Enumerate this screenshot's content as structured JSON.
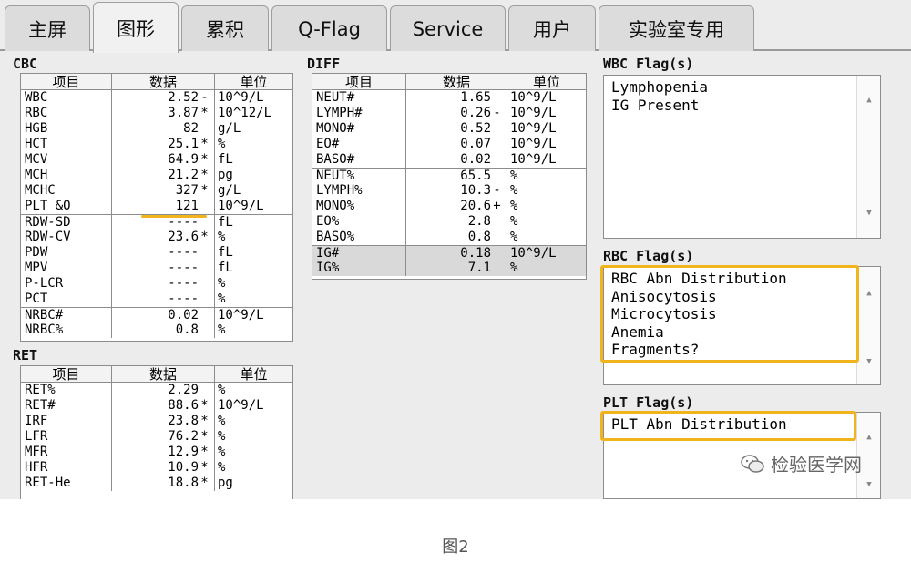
{
  "tabs": [
    {
      "label": "主屏"
    },
    {
      "label": "图形"
    },
    {
      "label": "累积"
    },
    {
      "label": "Q-Flag"
    },
    {
      "label": "Service"
    },
    {
      "label": "用户"
    },
    {
      "label": "实验室专用"
    }
  ],
  "active_tab": "图形",
  "cbc": {
    "title": "CBC",
    "headers": [
      "项目",
      "数据",
      "单位"
    ],
    "rows": [
      {
        "name": "WBC",
        "value": "2.52",
        "flag": "-",
        "unit": "10^9/L"
      },
      {
        "name": "RBC",
        "value": "3.87",
        "flag": "*",
        "unit": "10^12/L"
      },
      {
        "name": "HGB",
        "value": "82",
        "flag": "",
        "unit": "g/L"
      },
      {
        "name": "HCT",
        "value": "25.1",
        "flag": "*",
        "unit": "%"
      },
      {
        "name": "MCV",
        "value": "64.9",
        "flag": "*",
        "unit": "fL"
      },
      {
        "name": "MCH",
        "value": "21.2",
        "flag": "*",
        "unit": "pg"
      },
      {
        "name": "MCHC",
        "value": "327",
        "flag": "*",
        "unit": "g/L"
      },
      {
        "name": "PLT &O",
        "value": "121",
        "flag": "",
        "unit": "10^9/L"
      },
      {
        "name": "RDW-SD",
        "value": "----",
        "flag": "",
        "unit": "fL"
      },
      {
        "name": "RDW-CV",
        "value": "23.6",
        "flag": "*",
        "unit": "%"
      },
      {
        "name": "PDW",
        "value": "----",
        "flag": "",
        "unit": "fL"
      },
      {
        "name": "MPV",
        "value": "----",
        "flag": "",
        "unit": "fL"
      },
      {
        "name": "P-LCR",
        "value": "----",
        "flag": "",
        "unit": "%"
      },
      {
        "name": "PCT",
        "value": "----",
        "flag": "",
        "unit": "%"
      },
      {
        "name": "NRBC#",
        "value": "0.02",
        "flag": "",
        "unit": "10^9/L"
      },
      {
        "name": "NRBC%",
        "value": "0.8",
        "flag": "",
        "unit": "%"
      }
    ]
  },
  "ret": {
    "title": "RET",
    "headers": [
      "项目",
      "数据",
      "单位"
    ],
    "rows": [
      {
        "name": "RET%",
        "value": "2.29",
        "flag": "",
        "unit": "%"
      },
      {
        "name": "RET#",
        "value": "88.6",
        "flag": "*",
        "unit": "10^9/L"
      },
      {
        "name": "IRF",
        "value": "23.8",
        "flag": "*",
        "unit": "%"
      },
      {
        "name": "LFR",
        "value": "76.2",
        "flag": "*",
        "unit": "%"
      },
      {
        "name": "MFR",
        "value": "12.9",
        "flag": "*",
        "unit": "%"
      },
      {
        "name": "HFR",
        "value": "10.9",
        "flag": "*",
        "unit": "%"
      },
      {
        "name": "RET-He",
        "value": "18.8",
        "flag": "*",
        "unit": "pg"
      }
    ]
  },
  "diff": {
    "title": "DIFF",
    "headers": [
      "项目",
      "数据",
      "单位"
    ],
    "rows": [
      {
        "name": "NEUT#",
        "value": "1.65",
        "flag": "",
        "unit": "10^9/L"
      },
      {
        "name": "LYMPH#",
        "value": "0.26",
        "flag": "-",
        "unit": "10^9/L"
      },
      {
        "name": "MONO#",
        "value": "0.52",
        "flag": "",
        "unit": "10^9/L"
      },
      {
        "name": "EO#",
        "value": "0.07",
        "flag": "",
        "unit": "10^9/L"
      },
      {
        "name": "BASO#",
        "value": "0.02",
        "flag": "",
        "unit": "10^9/L"
      },
      {
        "name": "NEUT%",
        "value": "65.5",
        "flag": "",
        "unit": "%"
      },
      {
        "name": "LYMPH%",
        "value": "10.3",
        "flag": "-",
        "unit": "%"
      },
      {
        "name": "MONO%",
        "value": "20.6",
        "flag": "+",
        "unit": "%"
      },
      {
        "name": "EO%",
        "value": "2.8",
        "flag": "",
        "unit": "%"
      },
      {
        "name": "BASO%",
        "value": "0.8",
        "flag": "",
        "unit": "%"
      },
      {
        "name": "IG#",
        "value": "0.18",
        "flag": "",
        "unit": "10^9/L"
      },
      {
        "name": "IG%",
        "value": "7.1",
        "flag": "",
        "unit": "%"
      }
    ]
  },
  "wbc_flags": {
    "title": "WBC Flag(s)",
    "items": [
      "Lymphopenia",
      "IG Present"
    ]
  },
  "rbc_flags": {
    "title": "RBC Flag(s)",
    "items": [
      "RBC Abn Distribution",
      "Anisocytosis",
      "Microcytosis",
      "Anemia",
      "Fragments?"
    ]
  },
  "plt_flags": {
    "title": "PLT Flag(s)",
    "items": [
      "PLT Abn Distribution"
    ]
  },
  "scroll_arrows": {
    "up": "▲",
    "down": "▼"
  },
  "watermark": {
    "text": "检验医学网"
  },
  "caption": "图2",
  "colors": {
    "highlight": "#f2b41c",
    "panel": "#ececec",
    "shaded_row": "#d9d9d9"
  }
}
